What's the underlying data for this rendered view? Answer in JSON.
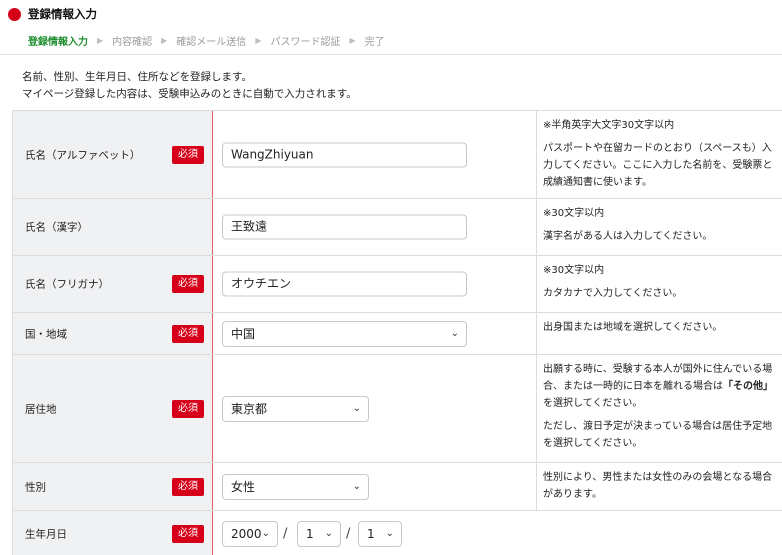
{
  "header": {
    "title": "登録情報入力",
    "steps": [
      "登録情報入力",
      "内容確認",
      "確認メール送信",
      "パスワード認証",
      "完了"
    ],
    "separator": "▶"
  },
  "intro": [
    "名前、性別、生年月日、住所などを登録します。",
    "マイページ登録した内容は、受験申込みのときに自動で入力されます。"
  ],
  "required_label": "必須",
  "fields": {
    "name_alpha": {
      "label": "氏名（アルファベット）",
      "value": "WangZhiyuan",
      "help": [
        "※半角英字大文字30文字以内",
        "パスポートや在留カードのとおり（スペースも）入力してください。ここに入力した名前を、受験票と成績通知書に使います。"
      ]
    },
    "name_kanji": {
      "label": "氏名（漢字）",
      "value": "王致遠",
      "help": [
        "※30文字以内",
        "漢字名がある人は入力してください。"
      ]
    },
    "name_kana": {
      "label": "氏名（フリガナ）",
      "value": "オウチエン",
      "help": [
        "※30文字以内",
        "カタカナで入力してください。"
      ]
    },
    "country": {
      "label": "国・地域",
      "value": "中国",
      "help": [
        "出身国または地域を選択してください。"
      ]
    },
    "residence": {
      "label": "居住地",
      "value": "東京都",
      "help_pre": "出願する時に、受験する本人が国外に住んでいる場合、または一時的に日本を離れる場合は",
      "help_bold": "「その他」",
      "help_post": "を選択してください。",
      "help_2": "ただし、渡日予定が決まっている場合は居住予定地を選択してください。"
    },
    "gender": {
      "label": "性別",
      "value": "女性",
      "help": [
        "性別により、男性または女性のみの会場となる場合があります。"
      ]
    },
    "birthdate": {
      "label": "生年月日",
      "year": "2000",
      "month": "1",
      "day": "1",
      "separator": "/"
    }
  },
  "icons": {
    "dropdown": "chevron-down-icon",
    "title_marker": "red-dot-icon"
  },
  "colors": {
    "accent_red": "#d7001a",
    "active_step_green": "#1f8f2f",
    "label_bg": "#f0f1f3"
  }
}
